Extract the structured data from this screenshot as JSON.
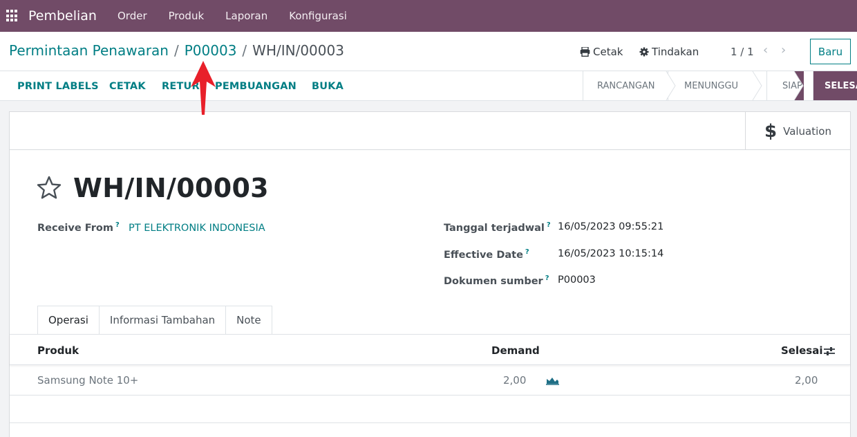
{
  "navbar": {
    "brand": "Pembelian",
    "items": [
      "Order",
      "Produk",
      "Laporan",
      "Konfigurasi"
    ],
    "color": "#714b67"
  },
  "breadcrumb": {
    "root": "Permintaan Penawaran",
    "parent": "P00003",
    "current": "WH/IN/00003"
  },
  "control": {
    "print": "Cetak",
    "action": "Tindakan",
    "pager": "1 / 1",
    "new": "Baru"
  },
  "actions": [
    "PRINT LABELS",
    "CETAK",
    "RETUR",
    "PEMBUANGAN",
    "BUKA"
  ],
  "stages": [
    "RANCANGAN",
    "MENUNGGU",
    "SIAP",
    "SELESAI"
  ],
  "active_stage": "SELESAI",
  "smart_button": {
    "label": "Valuation",
    "icon": "dollar-icon"
  },
  "record": {
    "title": "WH/IN/00003",
    "receive_from_label": "Receive From",
    "receive_from": "PT ELEKTRONIK INDONESIA",
    "scheduled_label": "Tanggal terjadwal",
    "scheduled": "16/05/2023 09:55:21",
    "effective_label": "Effective Date",
    "effective": "16/05/2023 10:15:14",
    "source_label": "Dokumen sumber",
    "source": "P00003",
    "help_mark": "?"
  },
  "tabs": [
    "Operasi",
    "Informasi Tambahan",
    "Note"
  ],
  "table": {
    "headers": {
      "product": "Produk",
      "demand": "Demand",
      "done": "Selesai"
    },
    "rows": [
      {
        "product": "Samsung Note 10+",
        "demand": "2,00",
        "done": "2,00"
      }
    ]
  },
  "accent": "#017e84",
  "annotation_color": "#e8202a"
}
